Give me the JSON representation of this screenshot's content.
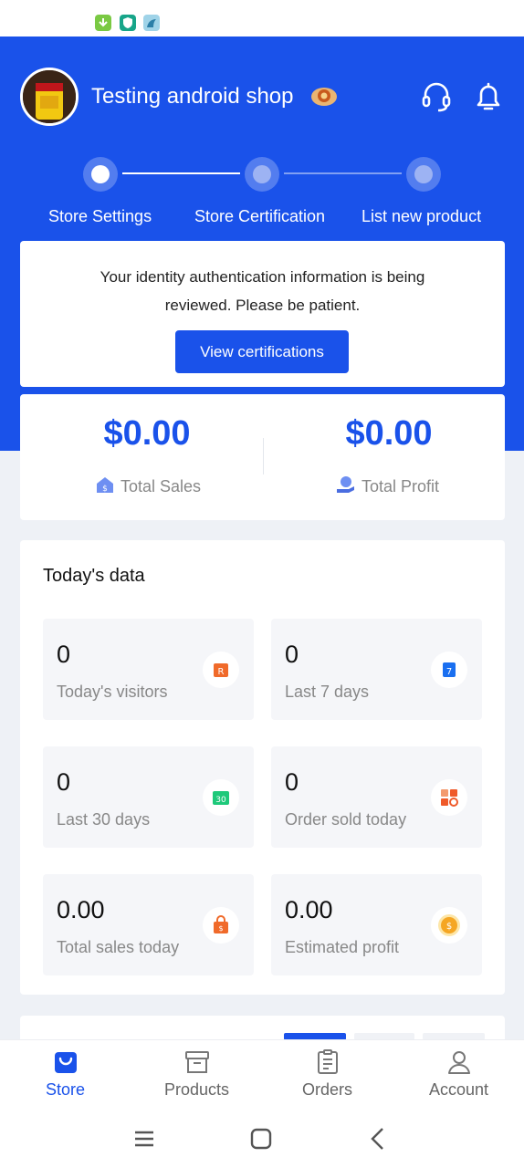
{
  "header": {
    "shop_name": "Testing android shop"
  },
  "steps": [
    {
      "label": "Store Settings",
      "state": "done"
    },
    {
      "label": "Store Certification",
      "state": "pending"
    },
    {
      "label": "List new product",
      "state": "pending"
    }
  ],
  "notice": {
    "text": "Your identity authentication information is being reviewed. Please be patient.",
    "button": "View certifications"
  },
  "summary": {
    "total_sales_value": "$0.00",
    "total_sales_label": "Total Sales",
    "total_profit_value": "$0.00",
    "total_profit_label": "Total Profit"
  },
  "today": {
    "title": "Today's data",
    "tiles": [
      {
        "value": "0",
        "label": "Today's visitors",
        "icon": "visitors-icon"
      },
      {
        "value": "0",
        "label": "Last 7 days",
        "icon": "calendar-7-icon"
      },
      {
        "value": "0",
        "label": "Last 30 days",
        "icon": "calendar-30-icon"
      },
      {
        "value": "0",
        "label": "Order sold today",
        "icon": "orders-search-icon"
      },
      {
        "value": "0.00",
        "label": "Total sales today",
        "icon": "shopping-bag-icon"
      },
      {
        "value": "0.00",
        "label": "Estimated profit",
        "icon": "coin-icon"
      }
    ]
  },
  "tabbar": {
    "items": [
      {
        "label": "Store",
        "active": true
      },
      {
        "label": "Products",
        "active": false
      },
      {
        "label": "Orders",
        "active": false
      },
      {
        "label": "Account",
        "active": false
      }
    ]
  },
  "colors": {
    "brand": "#1a52ea",
    "background": "#eef1f6",
    "muted_text": "#888888"
  }
}
